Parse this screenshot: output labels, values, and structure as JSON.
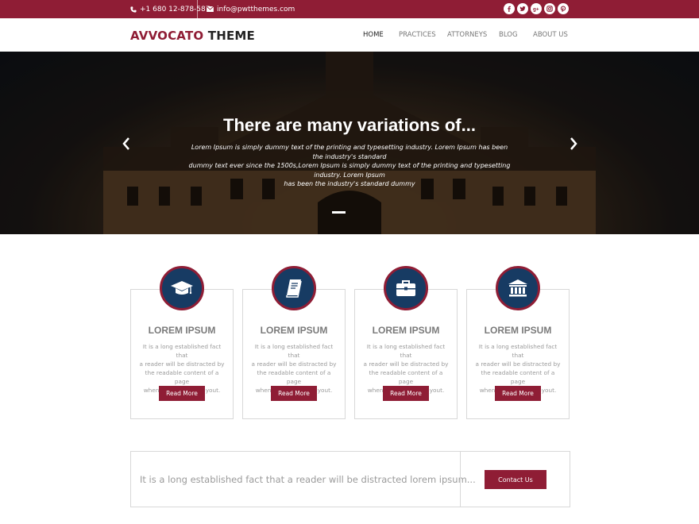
{
  "topbar": {
    "phone": "+1 680 12-878-587",
    "email": "info@pwtthemes.com",
    "social_icons": [
      "facebook-icon",
      "twitter-icon",
      "google-plus-icon",
      "instagram-icon",
      "pinterest-icon"
    ]
  },
  "header": {
    "logo_part1": "AVVOCATO",
    "logo_part2": "THEME",
    "nav": [
      {
        "label": "HOME",
        "active": true
      },
      {
        "label": "PRACTICES",
        "active": false
      },
      {
        "label": "ATTORNEYS",
        "active": false
      },
      {
        "label": "BLOG",
        "active": false
      },
      {
        "label": "ABOUT US",
        "active": false
      }
    ]
  },
  "hero": {
    "title": "There are many variations of...",
    "text_line1": "Lorem Ipsum is simply dummy text of the printing and typesetting industry. Lorem Ipsum has been the industry's standard",
    "text_line2": "dummy text ever since the 1500s,Lorem Ipsum is simply dummy text of the printing and typesetting industry. Lorem Ipsum",
    "text_line3": "has been the industry's standard dummy",
    "prev_icon": "chevron-left-icon",
    "next_icon": "chevron-right-icon"
  },
  "features": [
    {
      "icon": "graduation-cap-icon",
      "title": "LOREM IPSUM",
      "lines": [
        "It is a long established fact that",
        "a reader will be distracted by",
        "the readable content of a page",
        "when looking at its layout."
      ],
      "button": "Read More"
    },
    {
      "icon": "book-icon",
      "title": "LOREM IPSUM",
      "lines": [
        "It is a long established fact that",
        "a reader will be distracted by",
        "the readable content of a page",
        "when looking at its layout."
      ],
      "button": "Read More"
    },
    {
      "icon": "briefcase-icon",
      "title": "LOREM IPSUM",
      "lines": [
        "It is a long established fact that",
        "a reader will be distracted by",
        "the readable content of a page",
        "when looking at its layout."
      ],
      "button": "Read More"
    },
    {
      "icon": "bank-building-icon",
      "title": "LOREM IPSUM",
      "lines": [
        "It is a long established fact that",
        "a reader will be distracted by",
        "the readable content of a page",
        "when looking at its layout."
      ],
      "button": "Read More"
    }
  ],
  "callout": {
    "text": "It is a long established fact that a reader will be distracted lorem ipsum...",
    "button": "Contact Us"
  },
  "colors": {
    "brand": "#8f1d35",
    "badge": "#173b63",
    "text_muted": "#9a9a9a"
  }
}
